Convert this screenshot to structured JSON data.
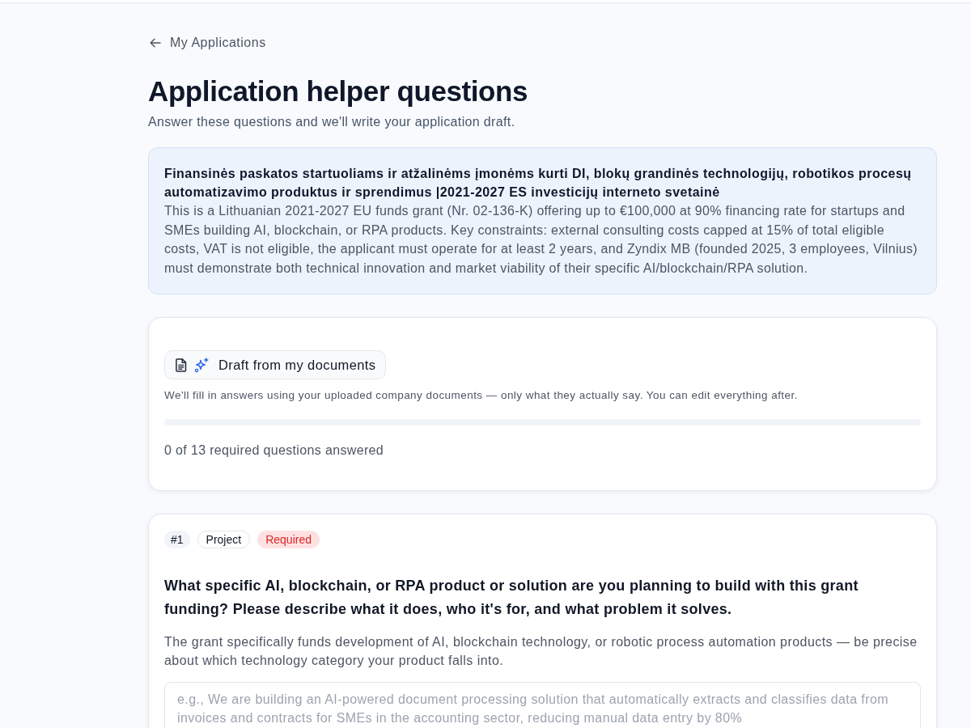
{
  "back_link": {
    "label": "My Applications"
  },
  "header": {
    "title": "Application helper questions",
    "subtitle": "Answer these questions and we'll write your application draft."
  },
  "grant_summary": {
    "title": "Finansinės paskatos startuoliams ir atžalinėms įmonėms kurti DI, blokų grandinės technologijų, robotikos procesų automatizavimo produktus ir sprendimus |2021-2027 ES investicijų interneto svetainė",
    "description": "This is a Lithuanian 2021-2027 EU funds grant (Nr. 02-136-K) offering up to €100,000 at 90% financing rate for startups and SMEs building AI, blockchain, or RPA products. Key constraints: external consulting costs capped at 15% of total eligible costs, VAT is not eligible, the applicant must operate for at least 2 years, and Zyndix MB (founded 2025, 3 employees, Vilnius) must demonstrate both technical innovation and market viability of their specific AI/blockchain/RPA solution."
  },
  "autofill": {
    "button": "Draft from my documents",
    "note": "We'll fill in answers using your uploaded company documents — only what they actually say. You can edit everything after.",
    "status": "0 of 13 required questions answered"
  },
  "questions": [
    {
      "badges": [
        {
          "kind": "number",
          "label": "#1"
        },
        {
          "kind": "category",
          "label": "Project"
        },
        {
          "kind": "required",
          "label": "Required"
        }
      ],
      "question": "What specific AI, blockchain, or RPA product or solution are you planning to build with this grant funding? Please describe what it does, who it's for, and what problem it solves.",
      "hint": "The grant specifically funds development of AI, blockchain technology, or robotic process automation products — be precise about which technology category your product falls into.",
      "answer": {
        "placeholder": "e.g., We are building an AI-powered document processing solution that automatically extracts and classifies data from invoices and contracts for SMEs in the accounting sector, reducing manual data entry by 80%"
      }
    }
  ]
}
